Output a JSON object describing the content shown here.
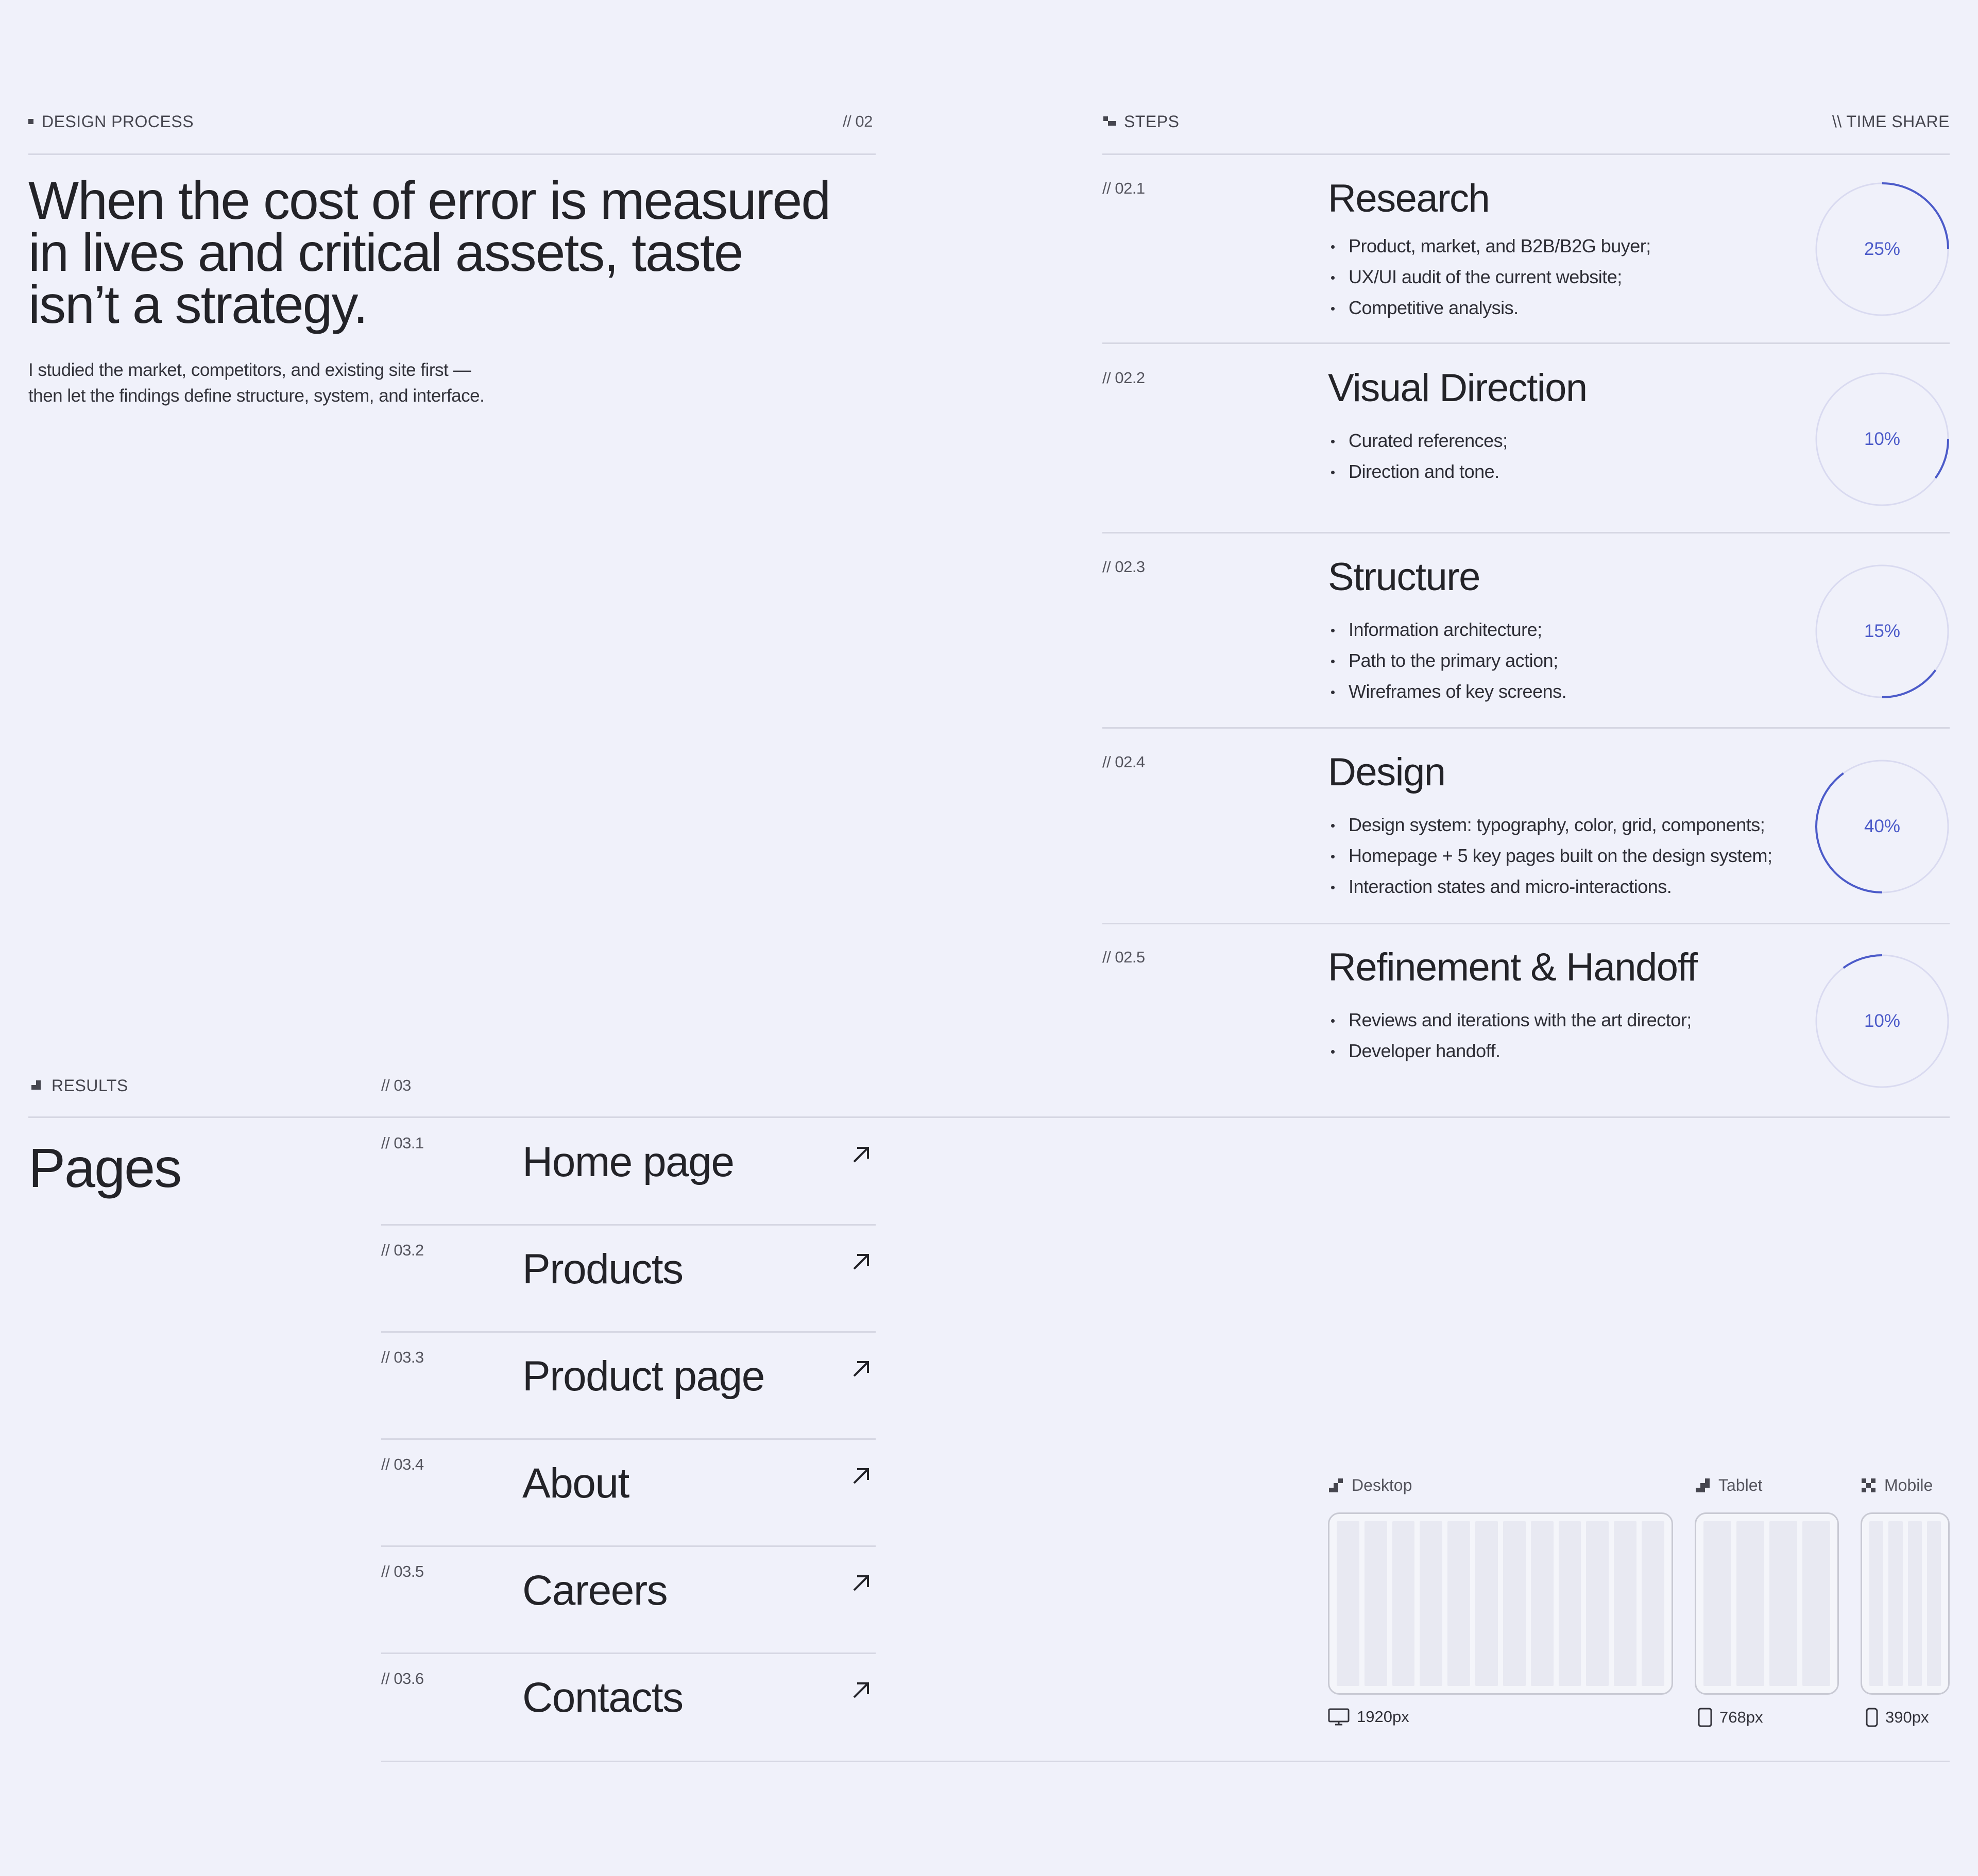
{
  "process": {
    "caption": "DESIGN PROCESS",
    "number": "// 02",
    "headline": [
      "When the cost of error is measured",
      "in lives and critical assets, taste",
      "isn’t a strategy."
    ],
    "lead": [
      "I studied the market, competitors, and existing site first —",
      "then let the findings define structure, system, and interface."
    ]
  },
  "steps": {
    "caption": "STEPS",
    "right_caption": "\\\\ TIME SHARE",
    "items": [
      {
        "num": "// 02.1",
        "title": "Research",
        "bullets": [
          "Product, market, and B2B/B2G buyer;",
          "UX/UI audit of the current website;",
          "Competitive analysis."
        ],
        "percent_label": "25%",
        "share": 0.25
      },
      {
        "num": "// 02.2",
        "title": "Visual Direction",
        "bullets": [
          "Curated references;",
          "Direction and tone."
        ],
        "percent_label": "10%",
        "share": 0.1
      },
      {
        "num": "// 02.3",
        "title": "Structure",
        "bullets": [
          "Information architecture;",
          "Path to the primary action;",
          "Wireframes of key screens."
        ],
        "percent_label": "15%",
        "share": 0.15
      },
      {
        "num": "// 02.4",
        "title": "Design",
        "bullets": [
          "Design system: typography, color, grid, components;",
          "Homepage + 5 key pages built on the design system;",
          "Interaction states and micro-interactions."
        ],
        "percent_label": "40%",
        "share": 0.4
      },
      {
        "num": "// 02.5",
        "title": "Refinement & Handoff",
        "bullets": [
          "Reviews and iterations with the art director;",
          "Developer handoff."
        ],
        "percent_label": "10%",
        "share": 0.1
      }
    ]
  },
  "results": {
    "caption": "RESULTS",
    "number": "// 03",
    "title": "Pages",
    "pages": [
      {
        "num": "// 03.1",
        "label": "Home page"
      },
      {
        "num": "// 03.2",
        "label": "Products"
      },
      {
        "num": "// 03.3",
        "label": "Product page"
      },
      {
        "num": "// 03.4",
        "label": "About"
      },
      {
        "num": "// 03.5",
        "label": "Careers"
      },
      {
        "num": "// 03.6",
        "label": "Contacts"
      }
    ]
  },
  "devices": {
    "desktop": {
      "label": "Desktop",
      "size": "1920px",
      "icon": "monitor-icon"
    },
    "tablet": {
      "label": "Tablet",
      "size": "768px",
      "icon": "tablet-icon"
    },
    "mobile": {
      "label": "Mobile",
      "size": "390px",
      "icon": "phone-icon"
    }
  },
  "colors": {
    "background": "#F0F1FA",
    "accent": "#4C5BC9",
    "ring_track": "#D9DAF0",
    "text": "#24242B"
  }
}
